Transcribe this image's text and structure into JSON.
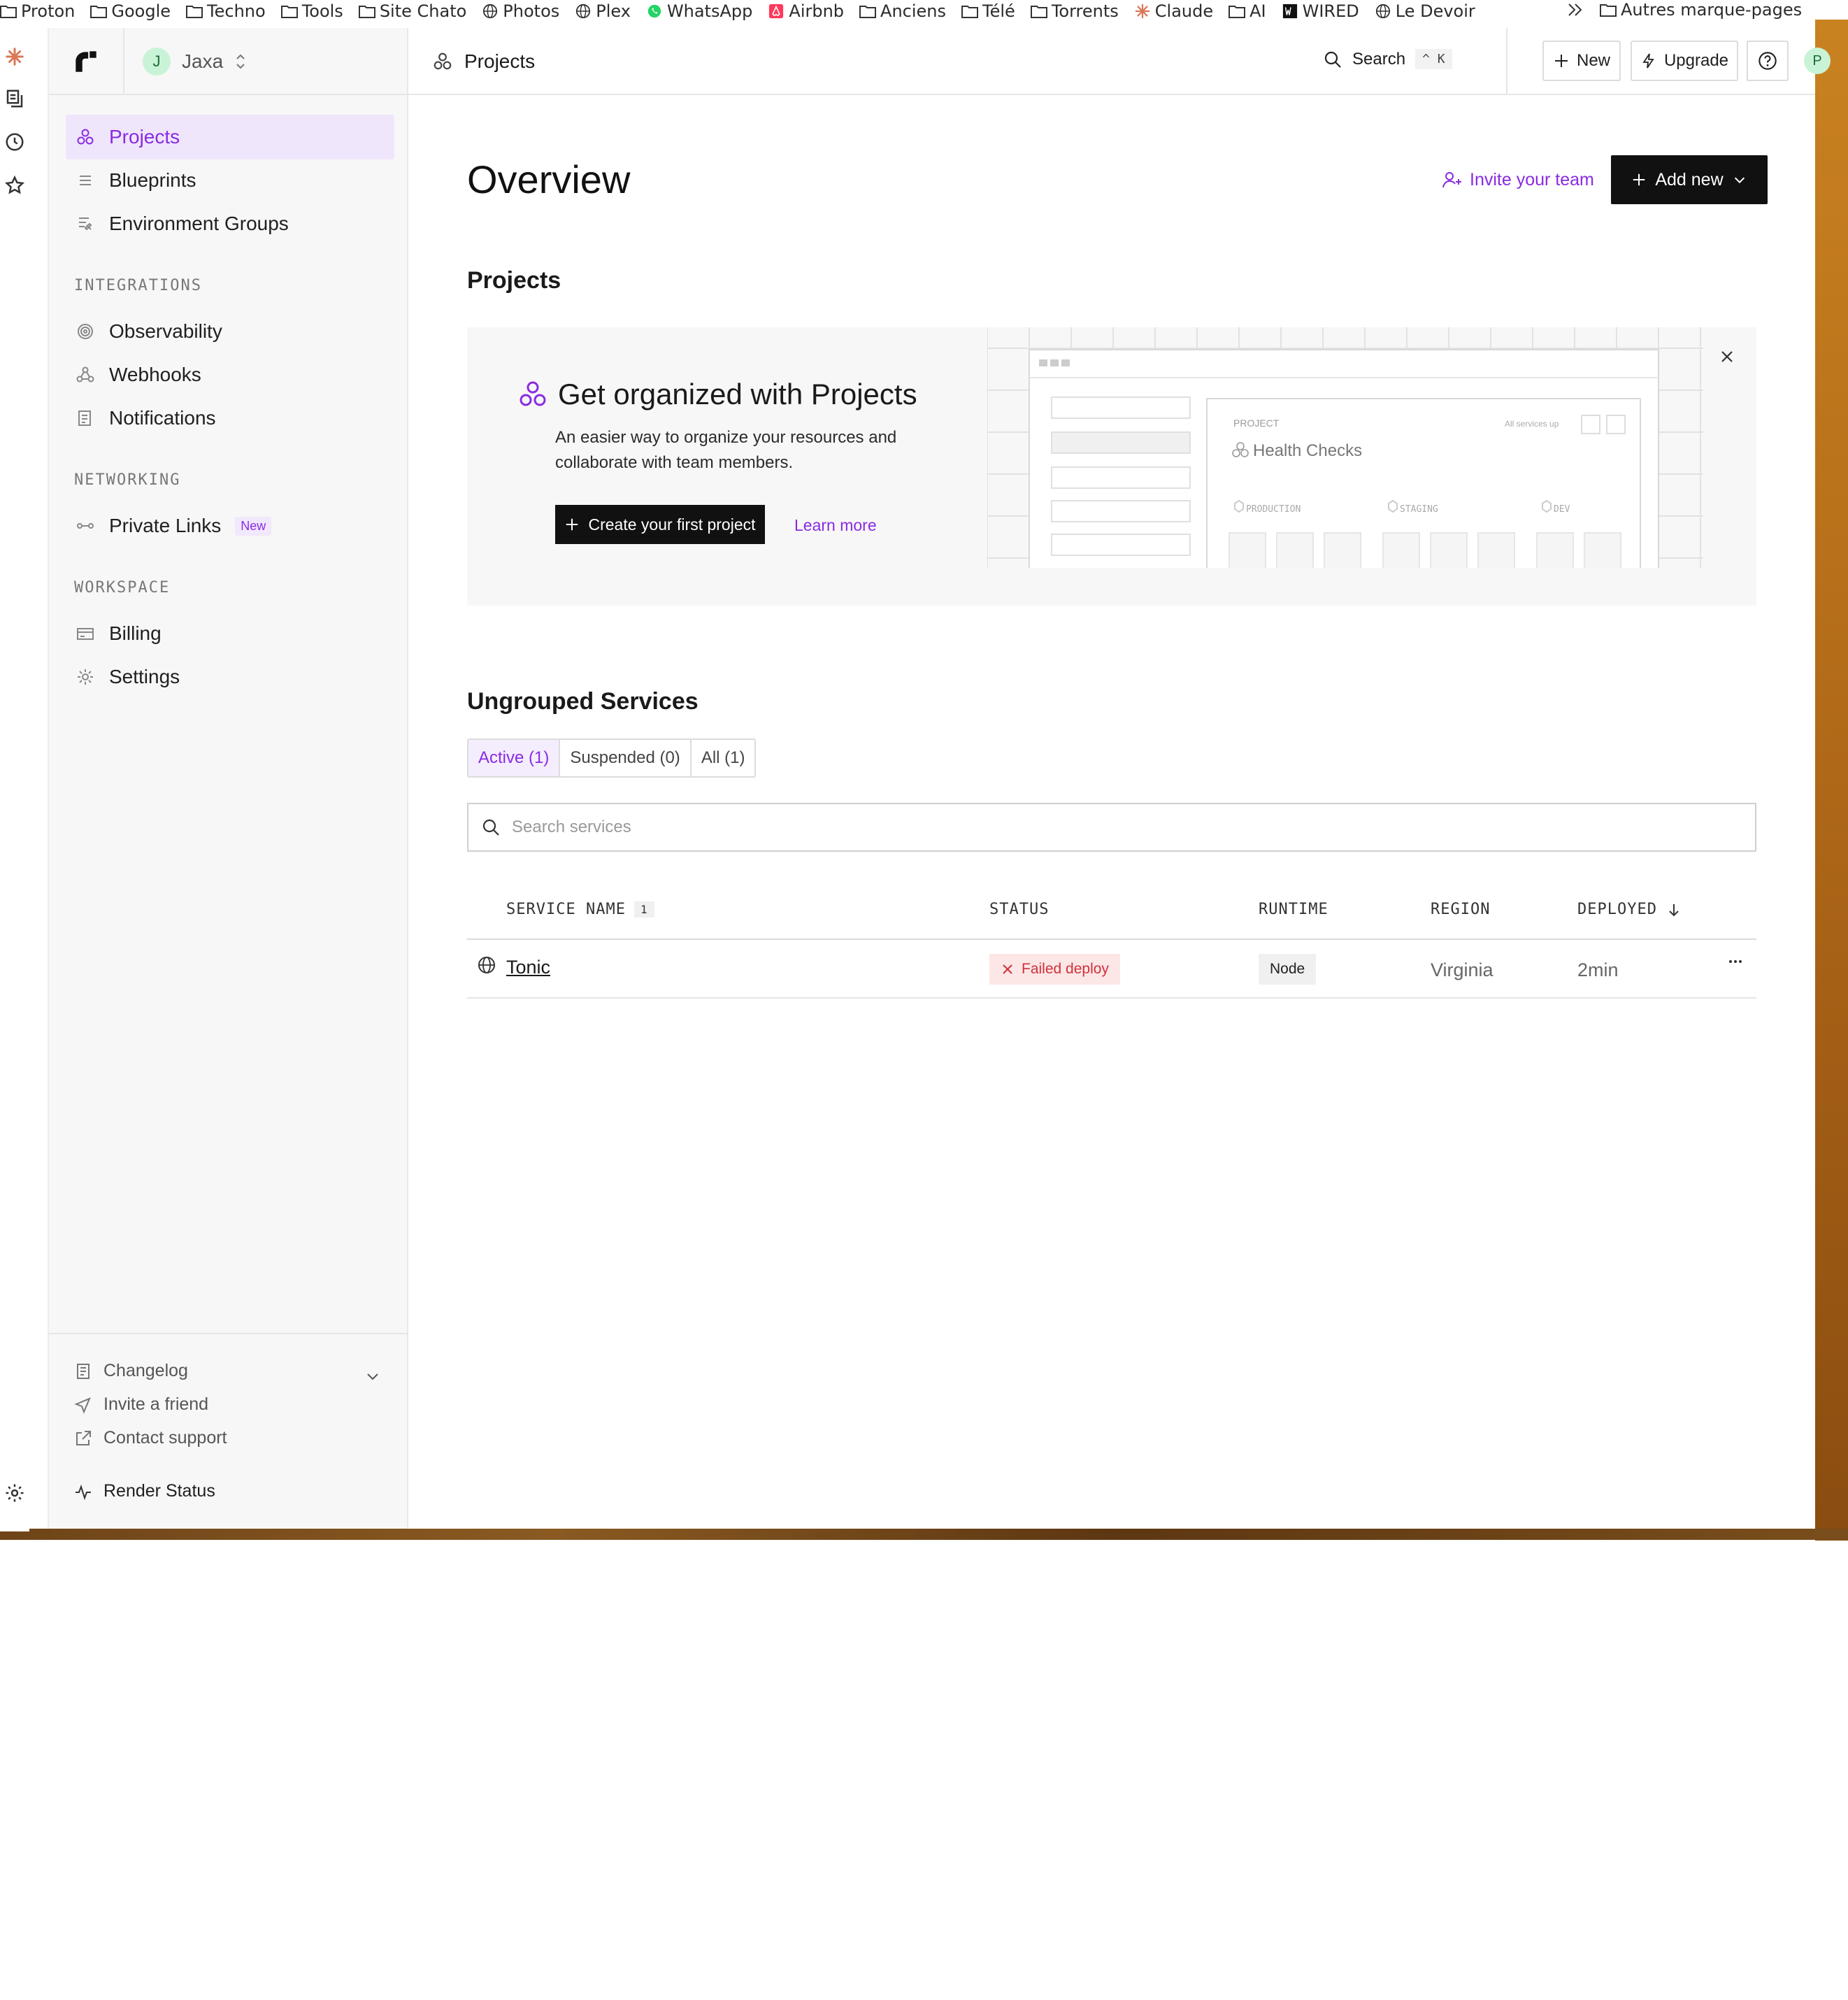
{
  "bookmarks": {
    "items": [
      {
        "label": "Proton",
        "icon": "folder-icon"
      },
      {
        "label": "Google",
        "icon": "folder-icon"
      },
      {
        "label": "Techno",
        "icon": "folder-icon"
      },
      {
        "label": "Tools",
        "icon": "folder-icon"
      },
      {
        "label": "Site Chato",
        "icon": "folder-icon"
      },
      {
        "label": "Photos",
        "icon": "globe-icon"
      },
      {
        "label": "Plex",
        "icon": "globe-icon"
      },
      {
        "label": "WhatsApp",
        "icon": "whatsapp-icon"
      },
      {
        "label": "Airbnb",
        "icon": "airbnb-icon"
      },
      {
        "label": "Anciens",
        "icon": "folder-icon"
      },
      {
        "label": "Télé",
        "icon": "folder-icon"
      },
      {
        "label": "Torrents",
        "icon": "folder-icon"
      },
      {
        "label": "Claude",
        "icon": "claude-icon"
      },
      {
        "label": "AI",
        "icon": "folder-icon"
      },
      {
        "label": "WIRED",
        "icon": "wired-icon"
      },
      {
        "label": "Le Devoir",
        "icon": "globe-icon"
      }
    ],
    "other": "Autres marque-pages"
  },
  "sidebar": {
    "workspace": {
      "initial": "J",
      "name": "Jaxa"
    },
    "nav": [
      {
        "label": "Projects",
        "icon": "projects-icon",
        "active": true
      },
      {
        "label": "Blueprints",
        "icon": "blueprints-icon"
      },
      {
        "label": "Environment Groups",
        "icon": "environment-groups-icon"
      }
    ],
    "integrations": {
      "heading": "INTEGRATIONS",
      "items": [
        {
          "label": "Observability",
          "icon": "observability-icon"
        },
        {
          "label": "Webhooks",
          "icon": "webhooks-icon"
        },
        {
          "label": "Notifications",
          "icon": "notifications-icon"
        }
      ]
    },
    "networking": {
      "heading": "NETWORKING",
      "items": [
        {
          "label": "Private Links",
          "icon": "private-links-icon",
          "badge": "New"
        }
      ]
    },
    "workspace_section": {
      "heading": "WORKSPACE",
      "items": [
        {
          "label": "Billing",
          "icon": "billing-icon"
        },
        {
          "label": "Settings",
          "icon": "settings-icon"
        }
      ]
    },
    "footer": {
      "changelog": "Changelog",
      "invite": "Invite a friend",
      "support": "Contact support",
      "status": "Render Status"
    }
  },
  "topbar": {
    "breadcrumb": "Projects",
    "search_label": "Search",
    "search_shortcut": "^ K",
    "new_label": "New",
    "upgrade_label": "Upgrade",
    "user_initial": "P"
  },
  "main": {
    "title": "Overview",
    "invite_team": "Invite your team",
    "add_new": "Add new",
    "projects_heading": "Projects",
    "promo": {
      "title": "Get organized with Projects",
      "description": "An easier way to organize your resources and collaborate with team members.",
      "cta": "Create your first project",
      "learn_more": "Learn more",
      "illustration": {
        "project_label": "PROJECT",
        "status": "All services up",
        "name": "Health Checks",
        "envs": [
          "PRODUCTION",
          "STAGING",
          "DEV"
        ]
      }
    },
    "services": {
      "heading": "Ungrouped Services",
      "tabs": [
        {
          "label": "Active (1)",
          "active": true
        },
        {
          "label": "Suspended (0)"
        },
        {
          "label": "All (1)"
        }
      ],
      "search_placeholder": "Search services",
      "columns": {
        "name": "SERVICE NAME",
        "name_count": "1",
        "status": "STATUS",
        "runtime": "RUNTIME",
        "region": "REGION",
        "deployed": "DEPLOYED"
      },
      "rows": [
        {
          "name": "Tonic",
          "status": "Failed deploy",
          "runtime": "Node",
          "region": "Virginia",
          "deployed": "2min"
        }
      ]
    }
  },
  "colors": {
    "accent": "#8a2be2",
    "active_bg": "#efe6fc",
    "danger": "#d0313c",
    "danger_bg": "#fde6e6",
    "wallpaper": "#b8701a"
  }
}
